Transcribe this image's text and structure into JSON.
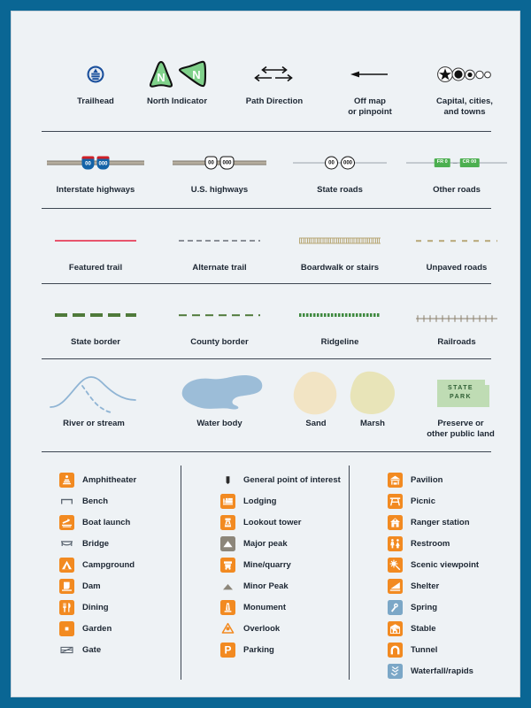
{
  "card": {
    "background": "#eef2f5",
    "frame_color": "#0a6694"
  },
  "sections": [
    {
      "name": "markers",
      "items": [
        {
          "label": "Trailhead",
          "icon": "trailhead-medallion-icon"
        },
        {
          "label": "North Indicator",
          "icon": "north-arrow-icon"
        },
        {
          "label": "Path Direction",
          "icon": "double-arrow-icon"
        },
        {
          "label": "Off map\nor pinpoint",
          "icon": "off-map-arrow-icon"
        },
        {
          "label": "Capital, cities,\nand towns",
          "icon": "city-dots-icon"
        }
      ]
    },
    {
      "name": "roads",
      "items": [
        {
          "label": "Interstate highways",
          "icon": "interstate-shield-icon",
          "badges": [
            "00",
            "000"
          ]
        },
        {
          "label": "U.S. highways",
          "icon": "us-shield-icon",
          "badges": [
            "00",
            "000"
          ]
        },
        {
          "label": "State roads",
          "icon": "state-shield-icon",
          "badges": [
            "00",
            "000"
          ]
        },
        {
          "label": "Other roads",
          "icon": "other-road-badge-icon",
          "badges": [
            "FR 0",
            "CR 00"
          ]
        }
      ]
    },
    {
      "name": "trails",
      "items": [
        {
          "label": "Featured trail",
          "icon": "solid-red-line-icon"
        },
        {
          "label": "Alternate trail",
          "icon": "dashed-gray-line-icon"
        },
        {
          "label": "Boardwalk or stairs",
          "icon": "boardwalk-hatch-line-icon"
        },
        {
          "label": "Unpaved roads",
          "icon": "unpaved-dashed-line-icon"
        }
      ]
    },
    {
      "name": "borders",
      "items": [
        {
          "label": "State border",
          "icon": "state-border-dash-icon"
        },
        {
          "label": "County border",
          "icon": "county-border-dash-icon"
        },
        {
          "label": "Ridgeline",
          "icon": "ridgeline-dotted-icon"
        },
        {
          "label": "Railroads",
          "icon": "railroad-crosstie-icon"
        }
      ]
    },
    {
      "name": "water-and-land",
      "items": [
        {
          "label": "River or stream",
          "icon": "river-stream-icon"
        },
        {
          "label": "Water body",
          "icon": "water-body-icon"
        },
        {
          "label": "Sand",
          "icon": "sand-patch-icon"
        },
        {
          "label": "Marsh",
          "icon": "marsh-patch-icon"
        },
        {
          "label": "Preserve or\nother public land",
          "icon": "state-park-patch-icon"
        }
      ]
    }
  ],
  "state_park_patch": {
    "line1": "STATE",
    "line2": "PARK"
  },
  "facility_columns": [
    {
      "name": "column-1",
      "items": [
        {
          "label": "Amphitheater",
          "icon": "amphitheater-icon",
          "style": "orange"
        },
        {
          "label": "Bench",
          "icon": "bench-icon",
          "style": "none"
        },
        {
          "label": "Boat launch",
          "icon": "boat-launch-icon",
          "style": "orange"
        },
        {
          "label": "Bridge",
          "icon": "bridge-icon",
          "style": "none"
        },
        {
          "label": "Campground",
          "icon": "campground-tent-icon",
          "style": "orange"
        },
        {
          "label": "Dam",
          "icon": "dam-icon",
          "style": "orange"
        },
        {
          "label": "Dining",
          "icon": "dining-fork-knife-icon",
          "style": "orange"
        },
        {
          "label": "Garden",
          "icon": "garden-icon",
          "style": "orange"
        },
        {
          "label": "Gate",
          "icon": "gate-icon",
          "style": "none"
        }
      ]
    },
    {
      "name": "column-2",
      "items": [
        {
          "label": "General point of interest",
          "icon": "general-point-of-interest-icon",
          "style": "none"
        },
        {
          "label": "Lodging",
          "icon": "lodging-bed-icon",
          "style": "orange"
        },
        {
          "label": "Lookout tower",
          "icon": "lookout-tower-icon",
          "style": "orange"
        },
        {
          "label": "Major peak",
          "icon": "major-peak-icon",
          "style": "gray"
        },
        {
          "label": "Mine/quarry",
          "icon": "mine-quarry-icon",
          "style": "orange"
        },
        {
          "label": "Minor Peak",
          "icon": "minor-peak-icon",
          "style": "none"
        },
        {
          "label": "Monument",
          "icon": "monument-icon",
          "style": "orange"
        },
        {
          "label": "Overlook",
          "icon": "overlook-icon",
          "style": "none"
        },
        {
          "label": "Parking",
          "icon": "parking-p-icon",
          "style": "orange"
        }
      ]
    },
    {
      "name": "column-3",
      "items": [
        {
          "label": "Pavilion",
          "icon": "pavilion-icon",
          "style": "orange"
        },
        {
          "label": "Picnic",
          "icon": "picnic-table-icon",
          "style": "orange"
        },
        {
          "label": "Ranger station",
          "icon": "ranger-station-icon",
          "style": "orange"
        },
        {
          "label": "Restroom",
          "icon": "restroom-icon",
          "style": "orange"
        },
        {
          "label": "Scenic viewpoint",
          "icon": "scenic-viewpoint-icon",
          "style": "orange"
        },
        {
          "label": "Shelter",
          "icon": "shelter-icon",
          "style": "orange"
        },
        {
          "label": "Spring",
          "icon": "spring-icon",
          "style": "blue"
        },
        {
          "label": "Stable",
          "icon": "stable-icon",
          "style": "orange"
        },
        {
          "label": "Tunnel",
          "icon": "tunnel-icon",
          "style": "orange"
        },
        {
          "label": "Waterfall/rapids",
          "icon": "waterfall-rapids-icon",
          "style": "blue"
        }
      ]
    }
  ],
  "colors": {
    "orange": "#f28a21",
    "blue_icon": "#7ba7c7",
    "gray_icon": "#8c867a",
    "trail_red": "#e8556d",
    "border_green": "#4f7a3a",
    "ridgeline_green": "#3f8a3f",
    "water_blue": "#9cbdd8",
    "sand": "#f2e4c4",
    "marsh": "#e8e4b8",
    "park_green": "#bfdcb4",
    "frame": "#0a6694",
    "text": "#1d2733"
  }
}
